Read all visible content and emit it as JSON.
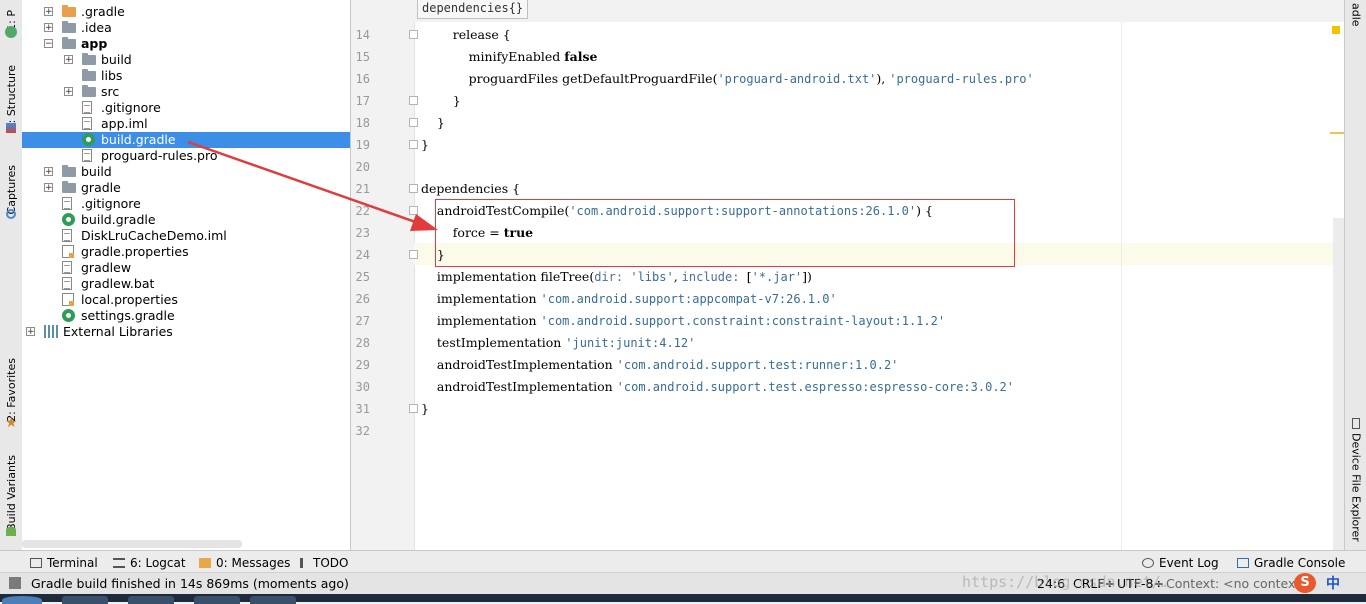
{
  "left_toolstrip": {
    "project_tab": "1: P",
    "structure_tab": "7: Structure",
    "captures_tab": "Captures",
    "favorites_tab": "2: Favorites",
    "build_variants_tab": "Build Variants"
  },
  "right_toolstrip": {
    "gradle_tab": "adle",
    "device_explorer_tab": "Device File Explorer"
  },
  "project_tree": [
    {
      "label": ".gradle",
      "indent": 1,
      "icon": "folder-orange-icon",
      "expander": "+",
      "bold": false
    },
    {
      "label": ".idea",
      "indent": 1,
      "icon": "folder-icon",
      "expander": "+",
      "bold": false
    },
    {
      "label": "app",
      "indent": 1,
      "icon": "module-folder-icon",
      "expander": "−",
      "bold": true
    },
    {
      "label": "build",
      "indent": 2,
      "icon": "folder-icon",
      "expander": "+",
      "bold": false
    },
    {
      "label": "libs",
      "indent": 2,
      "icon": "folder-icon",
      "expander": "",
      "bold": false
    },
    {
      "label": "src",
      "indent": 2,
      "icon": "folder-icon",
      "expander": "+",
      "bold": false
    },
    {
      "label": ".gitignore",
      "indent": 2,
      "icon": "file-icon",
      "expander": "",
      "bold": false
    },
    {
      "label": "app.iml",
      "indent": 2,
      "icon": "iml-file-icon",
      "expander": "",
      "bold": false
    },
    {
      "label": "build.gradle",
      "indent": 2,
      "icon": "gradle-icon",
      "expander": "",
      "bold": false,
      "selected": true
    },
    {
      "label": "proguard-rules.pro",
      "indent": 2,
      "icon": "file-icon",
      "expander": "",
      "bold": false
    },
    {
      "label": "build",
      "indent": 1,
      "icon": "folder-icon",
      "expander": "+",
      "bold": false
    },
    {
      "label": "gradle",
      "indent": 1,
      "icon": "folder-icon",
      "expander": "+",
      "bold": false
    },
    {
      "label": ".gitignore",
      "indent": 1,
      "icon": "file-icon",
      "expander": "",
      "bold": false
    },
    {
      "label": "build.gradle",
      "indent": 1,
      "icon": "gradle-icon",
      "expander": "",
      "bold": false
    },
    {
      "label": "DiskLruCacheDemo.iml",
      "indent": 1,
      "icon": "iml-file-icon",
      "expander": "",
      "bold": false
    },
    {
      "label": "gradle.properties",
      "indent": 1,
      "icon": "properties-file-icon",
      "expander": "",
      "bold": false
    },
    {
      "label": "gradlew",
      "indent": 1,
      "icon": "file-icon",
      "expander": "",
      "bold": false
    },
    {
      "label": "gradlew.bat",
      "indent": 1,
      "icon": "file-icon",
      "expander": "",
      "bold": false
    },
    {
      "label": "local.properties",
      "indent": 1,
      "icon": "properties-file-icon",
      "expander": "",
      "bold": false
    },
    {
      "label": "settings.gradle",
      "indent": 1,
      "icon": "gradle-icon",
      "expander": "",
      "bold": false
    },
    {
      "label": "External Libraries",
      "indent": 0,
      "icon": "libraries-icon",
      "expander": "+",
      "bold": false
    }
  ],
  "editor": {
    "breadcrumb": "dependencies{}",
    "line_numbers": [
      "14",
      "15",
      "16",
      "17",
      "18",
      "19",
      "20",
      "21",
      "22",
      "23",
      "24",
      "25",
      "26",
      "27",
      "28",
      "29",
      "30",
      "31",
      "32"
    ],
    "lines": [
      {
        "n": "14",
        "tokens": [
          [
            "t",
            "        release {"
          ]
        ]
      },
      {
        "n": "15",
        "tokens": [
          [
            "t",
            "            minifyEnabled "
          ],
          [
            "kwb",
            "false"
          ]
        ]
      },
      {
        "n": "16",
        "tokens": [
          [
            "t",
            "            proguardFiles getDefaultProguardFile("
          ],
          [
            "str",
            "'proguard-android.txt'"
          ],
          [
            "t",
            "), "
          ],
          [
            "str",
            "'proguard-rules.pro'"
          ]
        ]
      },
      {
        "n": "17",
        "tokens": [
          [
            "t",
            "        }"
          ]
        ]
      },
      {
        "n": "18",
        "tokens": [
          [
            "t",
            "    }"
          ]
        ]
      },
      {
        "n": "19",
        "tokens": [
          [
            "t",
            "}"
          ]
        ]
      },
      {
        "n": "20",
        "tokens": []
      },
      {
        "n": "21",
        "tokens": [
          [
            "t",
            "dependencies {"
          ]
        ]
      },
      {
        "n": "22",
        "tokens": [
          [
            "t",
            "    androidTestCompile("
          ],
          [
            "str",
            "'com.android.support:support-annotations:26.1.0'"
          ],
          [
            "t",
            ") {"
          ]
        ]
      },
      {
        "n": "23",
        "tokens": [
          [
            "t",
            "        force = "
          ],
          [
            "kwb",
            "true"
          ]
        ]
      },
      {
        "n": "24",
        "tokens": [
          [
            "t",
            "    }"
          ]
        ]
      },
      {
        "n": "25",
        "tokens": [
          [
            "t",
            "    implementation fileTree("
          ],
          [
            "nm",
            "dir: "
          ],
          [
            "str",
            "'libs'"
          ],
          [
            "t",
            ", "
          ],
          [
            "nm",
            "include: "
          ],
          [
            "t",
            "["
          ],
          [
            "str",
            "'*.jar'"
          ],
          [
            "t",
            "])"
          ]
        ]
      },
      {
        "n": "26",
        "tokens": [
          [
            "t",
            "    implementation "
          ],
          [
            "str",
            "'com.android.support:appcompat-v7:26.1.0'"
          ]
        ]
      },
      {
        "n": "27",
        "tokens": [
          [
            "t",
            "    implementation "
          ],
          [
            "str",
            "'com.android.support.constraint:constraint-layout:1.1.2'"
          ]
        ]
      },
      {
        "n": "28",
        "tokens": [
          [
            "t",
            "    testImplementation "
          ],
          [
            "str",
            "'junit:junit:4.12'"
          ]
        ]
      },
      {
        "n": "29",
        "tokens": [
          [
            "t",
            "    androidTestImplementation "
          ],
          [
            "str",
            "'com.android.support.test:runner:1.0.2'"
          ]
        ]
      },
      {
        "n": "30",
        "tokens": [
          [
            "t",
            "    androidTestImplementation "
          ],
          [
            "str",
            "'com.android.support.test.espresso:espresso-core:3.0.2'"
          ]
        ]
      },
      {
        "n": "31",
        "tokens": [
          [
            "t",
            "}"
          ]
        ]
      },
      {
        "n": "32",
        "tokens": []
      }
    ]
  },
  "bottom_tools": {
    "terminal": "Terminal",
    "logcat": "6: Logcat",
    "messages": "0: Messages",
    "todo": "TODO",
    "event_log": "Event Log",
    "gradle_console": "Gradle Console"
  },
  "status": {
    "message": "Gradle build finished in 14s 869ms (moments ago)",
    "position": "24:6",
    "line_separator": "CRLF÷",
    "encoding": "UTF-8÷",
    "context": "Context: <no context>",
    "watermark": "https://blog.csdn.net/…"
  },
  "ime": {
    "logo": "S",
    "lang": "中"
  },
  "colors": {
    "selection": "#3d8ee6",
    "annotation_red": "#e23b3b",
    "string": "#386d97",
    "keyword": "#000000"
  }
}
